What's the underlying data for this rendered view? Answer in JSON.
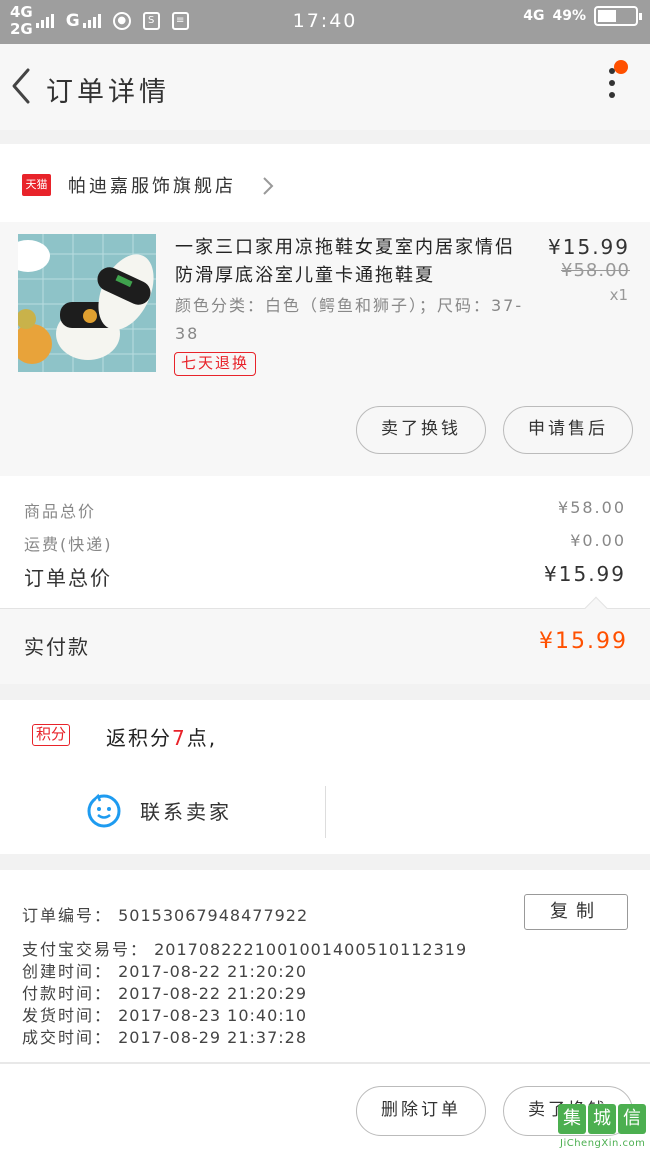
{
  "status_bar": {
    "network_1": "4G",
    "network_2": "2G",
    "network_3": "G",
    "time": "17:40",
    "right_network": "4G",
    "battery": "49%",
    "battery_level": 0.49
  },
  "header": {
    "title": "订单详情"
  },
  "shop": {
    "badge": "天猫",
    "name": "帕迪嘉服饰旗舰店"
  },
  "product": {
    "title": "一家三口家用凉拖鞋女夏室内居家情侣防滑厚底浴室儿童卡通拖鞋夏",
    "sku": "颜色分类：白色（鳄鱼和狮子）；尺码：37-38",
    "tag": "七天退换",
    "price": "¥15.99",
    "original_price": "¥58.00",
    "quantity": "x1",
    "btn_exchange": "卖了换钱",
    "btn_aftersale": "申请售后"
  },
  "summary": {
    "goods_label": "商品总价",
    "goods_value": "¥58.00",
    "shipping_label": "运费(快递)",
    "shipping_value": "¥0.00",
    "total_label": "订单总价",
    "total_value": "¥15.99",
    "paid_label": "实付款",
    "paid_value": "¥15.99"
  },
  "points": {
    "badge": "积分",
    "text_pre": "返积分",
    "points": "7",
    "text_post": "点,"
  },
  "contact": {
    "label": "联系卖家"
  },
  "order_info": {
    "order_no_label": "订单编号：",
    "order_no": "50153067948477922",
    "copy_label": "复制",
    "alipay_label": "支付宝交易号：",
    "alipay_no": "2017082221001001400510112319",
    "created_label": "创建时间：",
    "created": "2017-08-22  21:20:20",
    "paid_label": "付款时间：",
    "paid": "2017-08-22  21:20:29",
    "shipped_label": "发货时间：",
    "shipped": "2017-08-23  10:40:10",
    "done_label": "成交时间：",
    "done": "2017-08-29  21:37:28"
  },
  "bottom_bar": {
    "delete_label": "删除订单",
    "exchange_label": "卖了换钱"
  },
  "watermark": {
    "logo": "集城信",
    "url": "JiChengXin.com"
  }
}
